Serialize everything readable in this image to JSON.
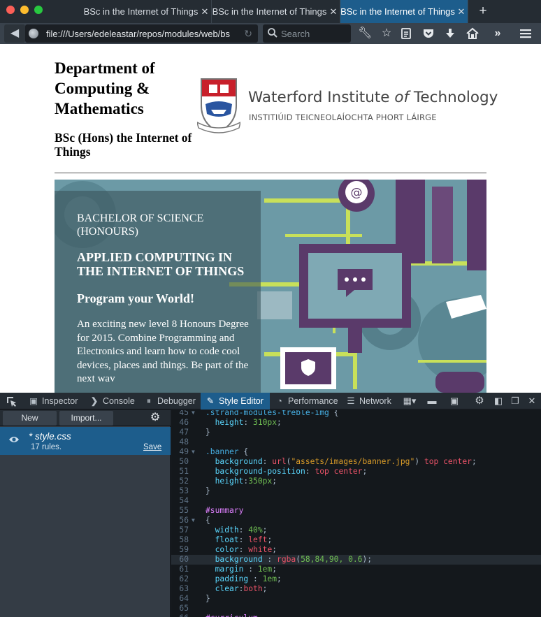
{
  "browser": {
    "tabs": [
      {
        "title": "BSc in the Internet of Things",
        "active": false
      },
      {
        "title": "BSc in the Internet of Things",
        "active": false
      },
      {
        "title": "BSc in the Internet of Things",
        "active": true
      }
    ],
    "new_tab_icon": "plus-icon",
    "url": "file:///Users/edeleastar/repos/modules/web/bs",
    "search_placeholder": "Search",
    "toolbar_icons": [
      "wrench-icon",
      "star-icon",
      "reading-list-icon",
      "pocket-icon",
      "download-icon",
      "home-icon",
      "overflow-icon",
      "menu-icon"
    ]
  },
  "page": {
    "dept_title": "Department of Computing & Mathematics",
    "course_title": "BSc (Hons) the Internet of Things",
    "logo": {
      "name_before": "Waterford Institute ",
      "name_of": "of",
      "name_after": " Technology",
      "irish": "INSTITIÚID TEICNEOLAÍOCHTA PHORT LÁIRGE"
    },
    "summary": {
      "kicker": "BACHELOR OF SCIENCE (HONOURS)",
      "heading": "APPLIED COMPUTING IN THE INTERNET OF THINGS",
      "tagline": "Program your World!",
      "body": "An exciting new level 8 Honours Degree for 2015. Combine Programming and Electronics and learn how to code cool devices, places and things. Be part of the next wav"
    },
    "colors": {
      "summary_bg": "#3a545a",
      "banner_bg": "#6c9aa6",
      "accent_lime": "#c8e05a",
      "accent_purple": "#5a3a6a"
    }
  },
  "devtools": {
    "tabs": [
      {
        "label": "Inspector",
        "icon": "inspector-icon"
      },
      {
        "label": "Console",
        "icon": "console-icon"
      },
      {
        "label": "Debugger",
        "icon": "debugger-icon"
      },
      {
        "label": "Style Editor",
        "icon": "style-editor-icon",
        "active": true
      },
      {
        "label": "Performance",
        "icon": "performance-icon"
      },
      {
        "label": "Network",
        "icon": "network-icon"
      }
    ],
    "sidebar": {
      "new_label": "New",
      "import_label": "Import...",
      "sheet_name": "* style.css",
      "sheet_rules": "17 rules.",
      "save_label": "Save"
    },
    "code": [
      {
        "n": "45",
        "fold": true,
        "text": ".strand-modules-treble-img {"
      },
      {
        "n": "46",
        "text": "  height: 310px;"
      },
      {
        "n": "47",
        "text": "}"
      },
      {
        "n": "48",
        "text": ""
      },
      {
        "n": "49",
        "fold": true,
        "text": ".banner {"
      },
      {
        "n": "50",
        "text": "  background: url(\"assets/images/banner.jpg\") top center;"
      },
      {
        "n": "51",
        "text": "  background-position: top center;"
      },
      {
        "n": "52",
        "text": "  height:350px;"
      },
      {
        "n": "53",
        "text": "}"
      },
      {
        "n": "54",
        "text": ""
      },
      {
        "n": "55",
        "text": "#summary"
      },
      {
        "n": "56",
        "fold": true,
        "text": "{"
      },
      {
        "n": "57",
        "text": "  width: 40%;"
      },
      {
        "n": "58",
        "text": "  float: left;"
      },
      {
        "n": "59",
        "text": "  color: white;"
      },
      {
        "n": "60",
        "current": true,
        "text": "  background : rgba(58,84,90, 0.6);"
      },
      {
        "n": "61",
        "text": "  margin : 1em;"
      },
      {
        "n": "62",
        "text": "  padding : 1em;"
      },
      {
        "n": "63",
        "text": "  clear:both;"
      },
      {
        "n": "64",
        "text": "}"
      },
      {
        "n": "65",
        "text": ""
      },
      {
        "n": "66",
        "text": "#curriculum"
      }
    ]
  }
}
